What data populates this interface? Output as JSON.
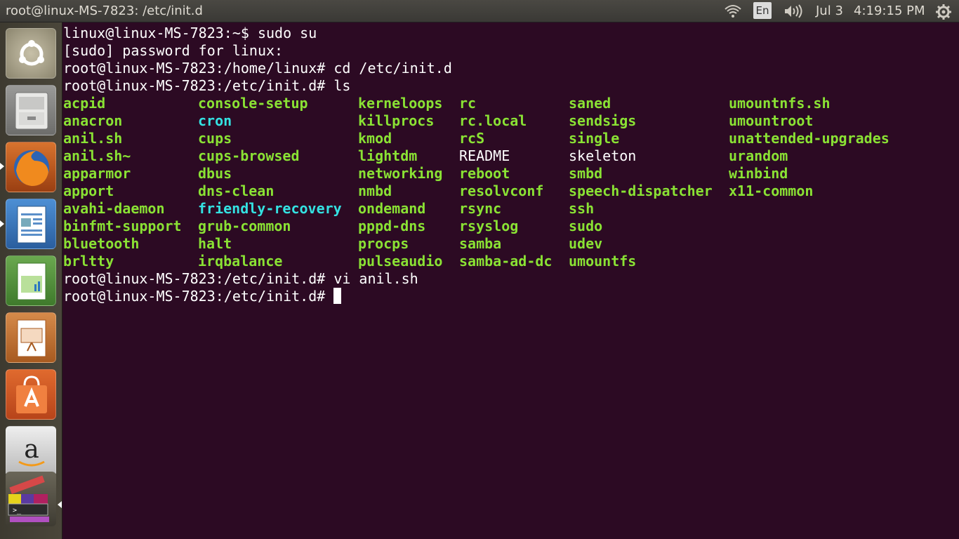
{
  "window": {
    "title": "root@linux-MS-7823: /etc/init.d"
  },
  "panel": {
    "keyboard_lang": "En",
    "date": "Jul 3",
    "time": "4:19:15 PM",
    "icons": [
      "wifi-icon",
      "keyboard-language-indicator",
      "volume-icon",
      "settings-gear-icon"
    ]
  },
  "launcher": {
    "items": [
      {
        "name": "ubuntu-dash",
        "icon": "ubuntu-logo-icon"
      },
      {
        "name": "files",
        "icon": "file-cabinet-icon"
      },
      {
        "name": "firefox",
        "icon": "firefox-icon"
      },
      {
        "name": "libreoffice-writer",
        "icon": "writer-icon"
      },
      {
        "name": "libreoffice-calc",
        "icon": "calc-icon"
      },
      {
        "name": "libreoffice-impress",
        "icon": "impress-icon"
      },
      {
        "name": "ubuntu-software-center",
        "icon": "shopping-bag-icon"
      },
      {
        "name": "amazon",
        "icon": "amazon-icon"
      },
      {
        "name": "stacked-apps",
        "icon": "terminal-stack-icon"
      }
    ]
  },
  "terminal": {
    "lines": [
      "linux@linux-MS-7823:~$ sudo su",
      "[sudo] password for linux:",
      "root@linux-MS-7823:/home/linux# cd /etc/init.d",
      "root@linux-MS-7823:/etc/init.d# ls"
    ],
    "ls_columns": [
      [
        "acpid",
        "anacron",
        "anil.sh",
        "anil.sh~",
        "apparmor",
        "apport",
        "avahi-daemon",
        "binfmt-support",
        "bluetooth",
        "brltty"
      ],
      [
        "console-setup",
        "cron",
        "cups",
        "cups-browsed",
        "dbus",
        "dns-clean",
        "friendly-recovery",
        "grub-common",
        "halt",
        "irqbalance"
      ],
      [
        "kerneloops",
        "killprocs",
        "kmod",
        "lightdm",
        "networking",
        "nmbd",
        "ondemand",
        "pppd-dns",
        "procps",
        "pulseaudio"
      ],
      [
        "rc",
        "rc.local",
        "rcS",
        "README",
        "reboot",
        "resolvconf",
        "rsync",
        "rsyslog",
        "samba",
        "samba-ad-dc"
      ],
      [
        "saned",
        "sendsigs",
        "single",
        "skeleton",
        "smbd",
        "speech-dispatcher",
        "ssh",
        "sudo",
        "udev",
        "umountfs"
      ],
      [
        "umountnfs.sh",
        "umountroot",
        "unattended-upgrades",
        "urandom",
        "winbind",
        "x11-common"
      ]
    ],
    "after_lines": [
      "root@linux-MS-7823:/etc/init.d# vi anil.sh",
      "root@linux-MS-7823:/etc/init.d# "
    ],
    "colors": {
      "executable": "#8ae234",
      "symlink": "#34e2e2",
      "plain": "#ffffff",
      "background": "#2c0a23"
    }
  }
}
